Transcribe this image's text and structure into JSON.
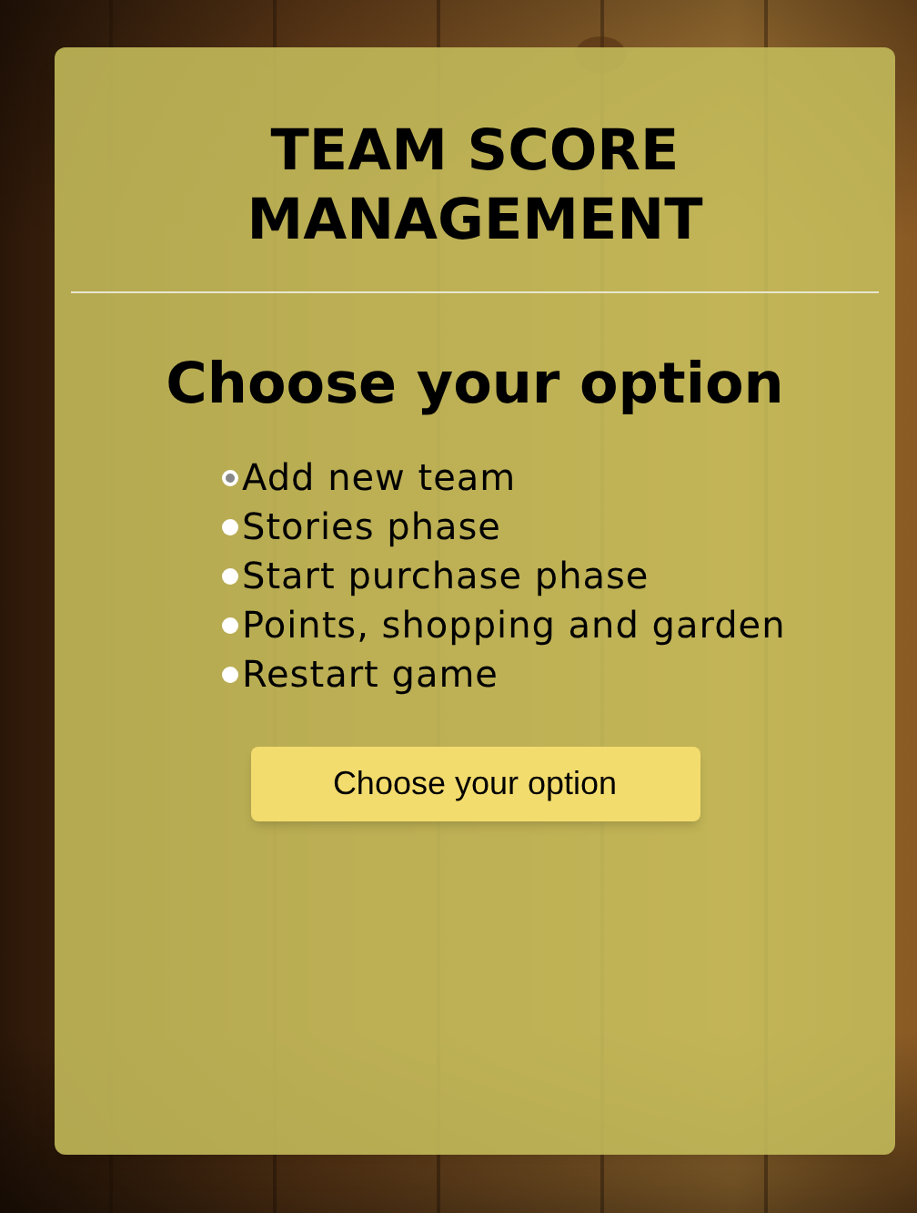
{
  "title": "TEAM SCORE MANAGEMENT",
  "heading": "Choose your option",
  "options": [
    {
      "label": "Add new team",
      "selected": true
    },
    {
      "label": "Stories phase",
      "selected": false
    },
    {
      "label": "Start purchase phase",
      "selected": false
    },
    {
      "label": "Points, shopping and garden",
      "selected": false
    },
    {
      "label": "Restart game",
      "selected": false
    }
  ],
  "button": "Choose your option"
}
